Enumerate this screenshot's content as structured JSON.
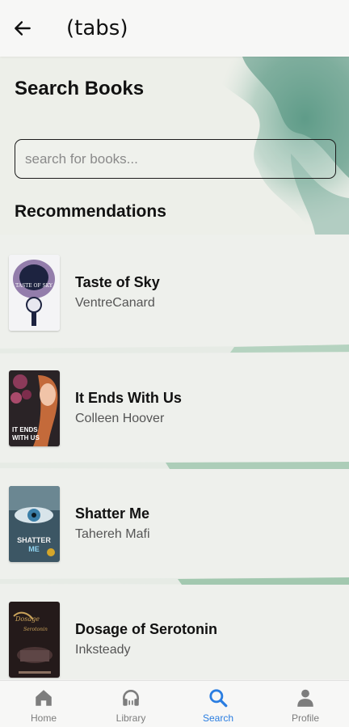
{
  "header": {
    "title": "(tabs)",
    "back_icon": "arrow-left-icon"
  },
  "page": {
    "title": "Search Books"
  },
  "search": {
    "placeholder": "search for books...",
    "value": ""
  },
  "recommendations": {
    "title": "Recommendations",
    "books": [
      {
        "title": "Taste of Sky",
        "author": "VentreCanard",
        "cover_text": "TASTE OF SKY"
      },
      {
        "title": "It Ends With Us",
        "author": "Colleen Hoover",
        "cover_text": "IT ENDS WITH US"
      },
      {
        "title": "Shatter Me",
        "author": "Tahereh Mafi",
        "cover_text": "SHATTER ME"
      },
      {
        "title": "Dosage of Serotonin",
        "author": "Inksteady",
        "cover_text": "Dosage of Serotonin"
      }
    ]
  },
  "tabbar": {
    "active": "search",
    "active_color": "#2a7de1",
    "items": [
      {
        "label": "Home",
        "icon": "home-icon"
      },
      {
        "label": "Library",
        "icon": "headphones-icon"
      },
      {
        "label": "Search",
        "icon": "search-icon"
      },
      {
        "label": "Profile",
        "icon": "person-icon"
      }
    ]
  }
}
